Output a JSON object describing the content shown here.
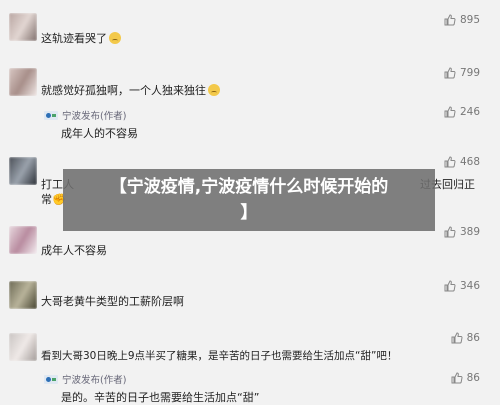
{
  "comments": [
    {
      "text": "这轨迹看哭了",
      "likes": "895",
      "emoji": true
    },
    {
      "text": "就感觉好孤独啊，一个人独来独往",
      "likes": "799",
      "emoji": true,
      "reply": {
        "author": "宁波发布(作者)",
        "text": "成年人的不容易"
      }
    },
    {
      "text": "打工人",
      "text_end": "过去回归正",
      "text_line2": "常",
      "likes": "468"
    },
    {
      "text": "成年人不容易",
      "likes": "389"
    },
    {
      "text": "大哥老黄牛类型的工薪阶层啊",
      "likes": "346"
    },
    {
      "text": "看到大哥30日晚上9点半买了糖果，是辛苦的日子也需要给生活加点“甜”吧！",
      "likes": "86",
      "reply": {
        "author": "宁波发布(作者)",
        "text": "是的。辛苦的日子也需要给生活加点“甜”"
      }
    },
    {
      "likes": "246"
    }
  ],
  "overlay": {
    "title_line1": "【宁波疫情,宁波疫情什么时候开始的",
    "title_line2": "】"
  }
}
